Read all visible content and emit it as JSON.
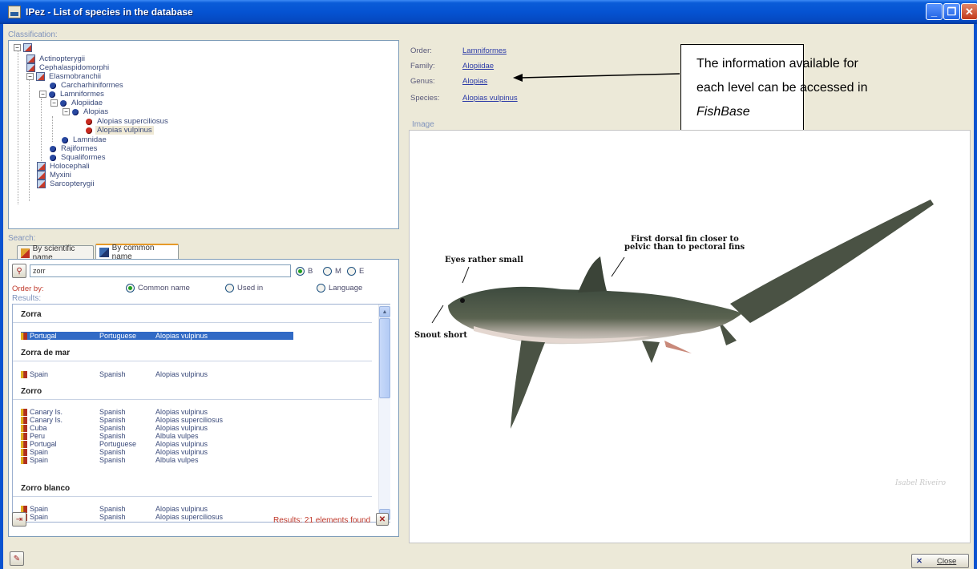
{
  "window": {
    "title": "IPez - List of species in the database"
  },
  "classification": {
    "label": "Classification:",
    "nodes": [
      {
        "label": "Actinopterygii"
      },
      {
        "label": "Cephalaspidomorphi"
      },
      {
        "label": "Elasmobranchii"
      },
      {
        "label": "Carcharhiniformes"
      },
      {
        "label": "Lamniformes"
      },
      {
        "label": "Alopiidae"
      },
      {
        "label": "Alopias"
      },
      {
        "label": "Alopias superciliosus"
      },
      {
        "label": "Alopias vulpinus"
      },
      {
        "label": "Lamnidae"
      },
      {
        "label": "Rajiformes"
      },
      {
        "label": "Squaliformes"
      },
      {
        "label": "Holocephali"
      },
      {
        "label": "Myxini"
      },
      {
        "label": "Sarcopterygii"
      }
    ]
  },
  "search": {
    "label": "Search:",
    "tabs": [
      {
        "label": "By scientific name"
      },
      {
        "label": "By common name"
      }
    ],
    "query": "zorr",
    "match_options": [
      {
        "label": "B",
        "checked": true
      },
      {
        "label": "M",
        "checked": false
      },
      {
        "label": "E",
        "checked": false
      }
    ],
    "order_by": {
      "label": "Order by:",
      "options": [
        {
          "label": "Common name",
          "checked": true
        },
        {
          "label": "Used in",
          "checked": false
        },
        {
          "label": "Language",
          "checked": false
        }
      ]
    },
    "results_label": "Results:",
    "groups": [
      {
        "name": "Zorra",
        "rows": [
          {
            "country": "Portugal",
            "language": "Portuguese",
            "species": "Alopias vulpinus",
            "selected": true
          }
        ]
      },
      {
        "name": "Zorra de mar",
        "rows": [
          {
            "country": "Spain",
            "language": "Spanish",
            "species": "Alopias vulpinus"
          }
        ]
      },
      {
        "name": "Zorro",
        "rows": [
          {
            "country": "Canary Is.",
            "language": "Spanish",
            "species": "Alopias vulpinus"
          },
          {
            "country": "Canary Is.",
            "language": "Spanish",
            "species": "Alopias superciliosus"
          },
          {
            "country": "Cuba",
            "language": "Spanish",
            "species": "Alopias vulpinus"
          },
          {
            "country": "Peru",
            "language": "Spanish",
            "species": "Albula vulpes"
          },
          {
            "country": "Portugal",
            "language": "Portuguese",
            "species": "Alopias vulpinus"
          },
          {
            "country": "Spain",
            "language": "Spanish",
            "species": "Alopias vulpinus"
          },
          {
            "country": "Spain",
            "language": "Spanish",
            "species": "Albula vulpes"
          }
        ]
      },
      {
        "name": "Zorro blanco",
        "rows": [
          {
            "country": "Spain",
            "language": "Spanish",
            "species": "Alopias vulpinus"
          },
          {
            "country": "Spain",
            "language": "Spanish",
            "species": "Alopias superciliosus"
          }
        ]
      }
    ],
    "results_count": "Results: 21 elements found"
  },
  "taxonomy": {
    "order_label": "Order:",
    "order": "Lamniformes",
    "family_label": "Family:",
    "family": "Alopiidae",
    "genus_label": "Genus:",
    "genus": "Alopias",
    "species_label": "Species:",
    "species": "Alopias vulpinus"
  },
  "callout": {
    "line1": "The information available for",
    "line2": "each level can be accessed in",
    "line3": "FishBase"
  },
  "image": {
    "label": "Image",
    "annotations": {
      "eyes": "Eyes rather small",
      "snout": "Snout short",
      "dorsal_1": "First dorsal fin closer to",
      "dorsal_2": "pelvic than to pectoral fins"
    },
    "credit": "Isabel Riveiro"
  },
  "footer": {
    "close_label": "Close"
  },
  "colors": {
    "accent": "#316ac5",
    "link": "#2b3aa7",
    "warning": "#c0392b",
    "titlebar": "#0553d2"
  }
}
